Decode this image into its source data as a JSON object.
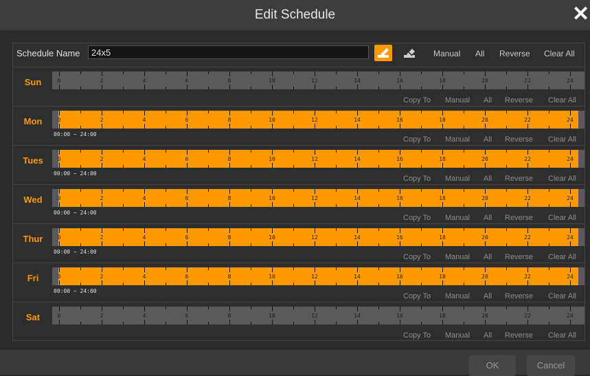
{
  "dialog": {
    "title": "Edit Schedule"
  },
  "toolbar": {
    "schedule_name_label": "Schedule Name",
    "schedule_name_value": "24x5",
    "manual_label": "Manual",
    "all_label": "All",
    "reverse_label": "Reverse",
    "clear_all_label": "Clear All"
  },
  "hour_labels": [
    "0",
    "2",
    "4",
    "6",
    "8",
    "10",
    "12",
    "14",
    "16",
    "18",
    "20",
    "22",
    "24"
  ],
  "row_actions": {
    "copy_to": "Copy To",
    "manual": "Manual",
    "all": "All",
    "reverse": "Reverse",
    "clear_all": "Clear All"
  },
  "days": [
    {
      "name": "Sun",
      "active": false,
      "range": ""
    },
    {
      "name": "Mon",
      "active": true,
      "range": "00:00 ~ 24:00"
    },
    {
      "name": "Tues",
      "active": true,
      "range": "00:00 ~ 24:00"
    },
    {
      "name": "Wed",
      "active": true,
      "range": "00:00 ~ 24:00"
    },
    {
      "name": "Thur",
      "active": true,
      "range": "00:00 ~ 24:00"
    },
    {
      "name": "Fri",
      "active": true,
      "range": "00:00 ~ 24:00"
    },
    {
      "name": "Sat",
      "active": false,
      "range": ""
    }
  ],
  "footer": {
    "ok_label": "OK",
    "cancel_label": "Cancel"
  },
  "colors": {
    "accent": "#ff9900",
    "inactive_bar": "#5a5a5a"
  }
}
